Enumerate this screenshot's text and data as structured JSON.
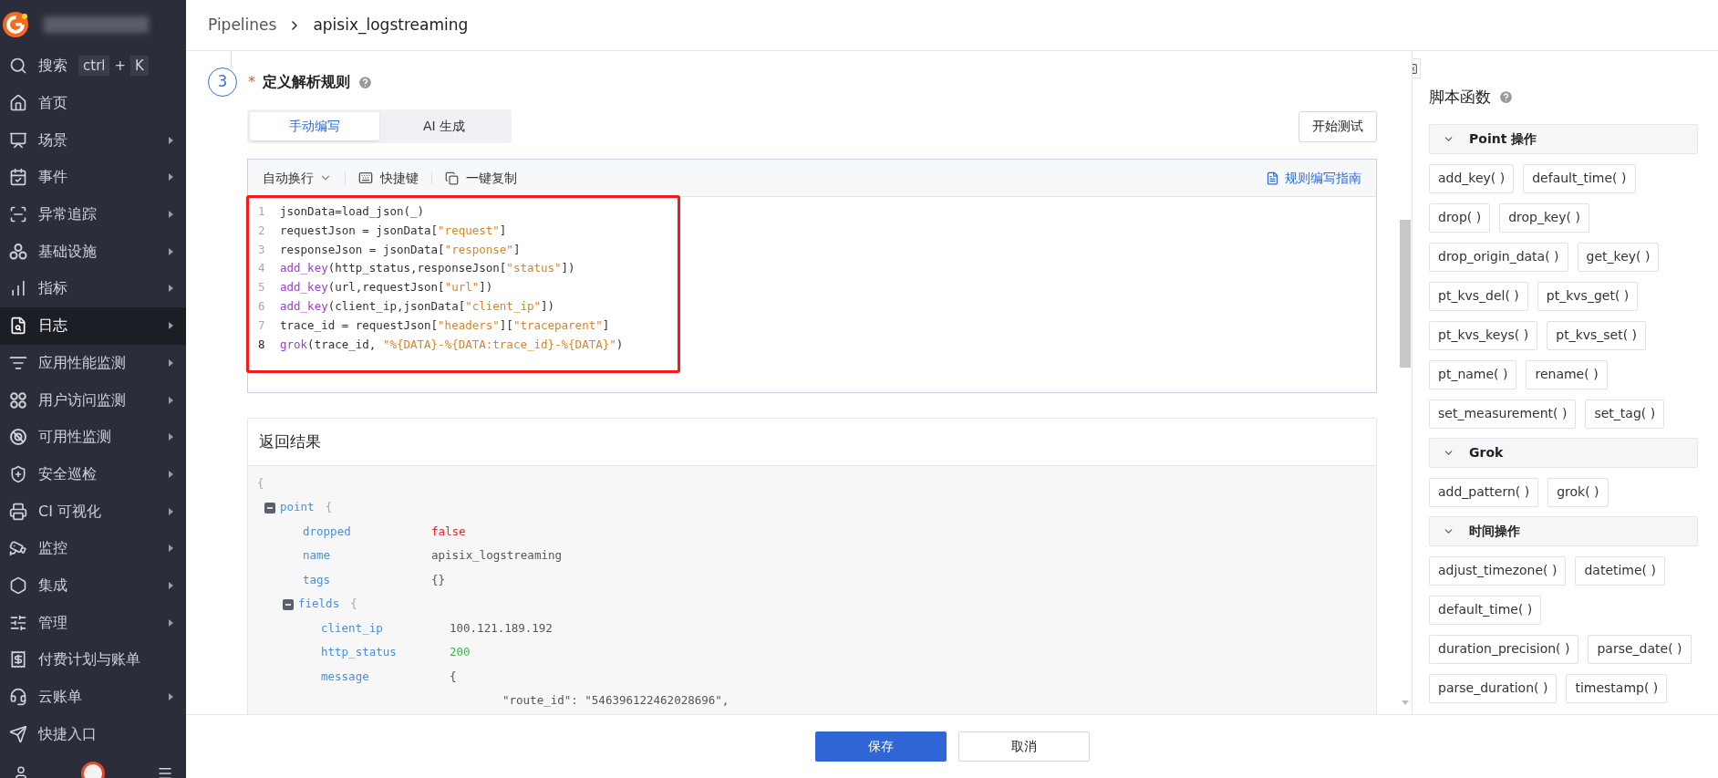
{
  "sidebar": {
    "items": [
      {
        "label": "搜索",
        "shortcut": [
          "ctrl",
          "+",
          "K"
        ],
        "has_submenu": false,
        "selected": false
      },
      {
        "label": "首页",
        "has_submenu": false,
        "selected": false
      },
      {
        "label": "场景",
        "has_submenu": true,
        "selected": false
      },
      {
        "label": "事件",
        "has_submenu": true,
        "selected": false
      },
      {
        "label": "异常追踪",
        "has_submenu": true,
        "selected": false
      },
      {
        "label": "基础设施",
        "has_submenu": true,
        "selected": false
      },
      {
        "label": "指标",
        "has_submenu": true,
        "selected": false
      },
      {
        "label": "日志",
        "has_submenu": true,
        "selected": true
      },
      {
        "label": "应用性能监测",
        "has_submenu": true,
        "selected": false
      },
      {
        "label": "用户访问监测",
        "has_submenu": true,
        "selected": false
      },
      {
        "label": "可用性监测",
        "has_submenu": true,
        "selected": false
      },
      {
        "label": "安全巡检",
        "has_submenu": true,
        "selected": false
      },
      {
        "label": "CI 可视化",
        "has_submenu": true,
        "selected": false
      },
      {
        "label": "监控",
        "has_submenu": true,
        "selected": false
      },
      {
        "label": "集成",
        "has_submenu": true,
        "selected": false
      },
      {
        "label": "管理",
        "has_submenu": true,
        "selected": false
      },
      {
        "label": "付费计划与账单",
        "has_submenu": false,
        "selected": false
      },
      {
        "label": "云账单",
        "has_submenu": true,
        "selected": false
      },
      {
        "label": "快捷入口",
        "has_submenu": false,
        "selected": false
      }
    ]
  },
  "breadcrumb": [
    "Pipelines",
    "apisix_logstreaming"
  ],
  "step": {
    "number": "3",
    "title": "定义解析规则",
    "required_mark": "*"
  },
  "tabs": [
    {
      "label": "手动编写",
      "selected": true
    },
    {
      "label": "AI 生成",
      "selected": false
    }
  ],
  "test_button": "开始测试",
  "editor": {
    "wrap_dropdown": "自动换行",
    "shortcuts": "快捷键",
    "copy": "一键复制",
    "guide_link": "规则编写指南",
    "lines": [
      {
        "number": "1",
        "current": false,
        "tokens": [
          {
            "kind": "plain",
            "text": "jsonData=load_json(_)"
          }
        ]
      },
      {
        "number": "2",
        "current": false,
        "tokens": [
          {
            "kind": "plain",
            "text": "requestJson = jsonData["
          },
          {
            "kind": "string",
            "text": "\"request\""
          },
          {
            "kind": "plain",
            "text": "]"
          }
        ]
      },
      {
        "number": "3",
        "current": false,
        "tokens": [
          {
            "kind": "plain",
            "text": "responseJson = jsonData["
          },
          {
            "kind": "string",
            "text": "\"response\""
          },
          {
            "kind": "plain",
            "text": "]"
          }
        ]
      },
      {
        "number": "4",
        "current": false,
        "tokens": [
          {
            "kind": "func",
            "text": "add_key"
          },
          {
            "kind": "plain",
            "text": "(http_status,responseJson["
          },
          {
            "kind": "string",
            "text": "\"status\""
          },
          {
            "kind": "plain",
            "text": "])"
          }
        ]
      },
      {
        "number": "5",
        "current": false,
        "tokens": [
          {
            "kind": "func",
            "text": "add_key"
          },
          {
            "kind": "plain",
            "text": "(url,requestJson["
          },
          {
            "kind": "string",
            "text": "\"url\""
          },
          {
            "kind": "plain",
            "text": "])"
          }
        ]
      },
      {
        "number": "6",
        "current": false,
        "tokens": [
          {
            "kind": "func",
            "text": "add_key"
          },
          {
            "kind": "plain",
            "text": "(client_ip,jsonData["
          },
          {
            "kind": "string",
            "text": "\"client_ip\""
          },
          {
            "kind": "plain",
            "text": "])"
          }
        ]
      },
      {
        "number": "7",
        "current": false,
        "tokens": [
          {
            "kind": "plain",
            "text": "trace_id = requestJson["
          },
          {
            "kind": "string",
            "text": "\"headers\""
          },
          {
            "kind": "plain",
            "text": "]["
          },
          {
            "kind": "string",
            "text": "\"traceparent\""
          },
          {
            "kind": "plain",
            "text": "]"
          }
        ]
      },
      {
        "number": "8",
        "current": true,
        "tokens": [
          {
            "kind": "func",
            "text": "grok"
          },
          {
            "kind": "plain",
            "text": "(trace_id, "
          },
          {
            "kind": "string",
            "text": "\"%{DATA}-%{DATA:trace_id}-%{DATA}\""
          },
          {
            "kind": "plain",
            "text": ")"
          }
        ]
      }
    ]
  },
  "result": {
    "title": "返回结果",
    "open": "{",
    "nodes": [
      {
        "kind": "object",
        "key": "point",
        "brace": "{",
        "expanded": true,
        "children": [
          {
            "kind": "boolean",
            "key": "dropped",
            "value": "false"
          },
          {
            "kind": "string",
            "key": "name",
            "value": "apisix_logstreaming"
          },
          {
            "kind": "plain",
            "key": "tags",
            "value": "{}"
          },
          {
            "kind": "object",
            "key": "fields",
            "brace": "{",
            "expanded": true,
            "children": [
              {
                "kind": "string",
                "key": "client_ip",
                "value": "100.121.189.192"
              },
              {
                "kind": "number",
                "key": "http_status",
                "value": "200"
              },
              {
                "kind": "plain",
                "key": "message",
                "value": "{",
                "continuation": "\"route_id\": \"546396122462028696\","
              }
            ]
          }
        ]
      }
    ]
  },
  "functions_panel": {
    "title": "脚本函数",
    "sections": [
      {
        "title": "Point 操作",
        "expanded": true,
        "functions": [
          "add_key( )",
          "default_time( )",
          "drop( )",
          "drop_key( )",
          "drop_origin_data( )",
          "get_key( )",
          "pt_kvs_del( )",
          "pt_kvs_get( )",
          "pt_kvs_keys( )",
          "pt_kvs_set( )",
          "pt_name( )",
          "rename( )",
          "set_measurement( )",
          "set_tag( )"
        ]
      },
      {
        "title": "Grok",
        "expanded": true,
        "functions": [
          "add_pattern( )",
          "grok( )"
        ]
      },
      {
        "title": "时间操作",
        "expanded": true,
        "functions": [
          "adjust_timezone( )",
          "datetime( )",
          "default_time( )",
          "duration_precision( )",
          "parse_date( )",
          "parse_duration( )",
          "timestamp( )"
        ]
      }
    ]
  },
  "footer": {
    "save": "保存",
    "cancel": "取消"
  }
}
